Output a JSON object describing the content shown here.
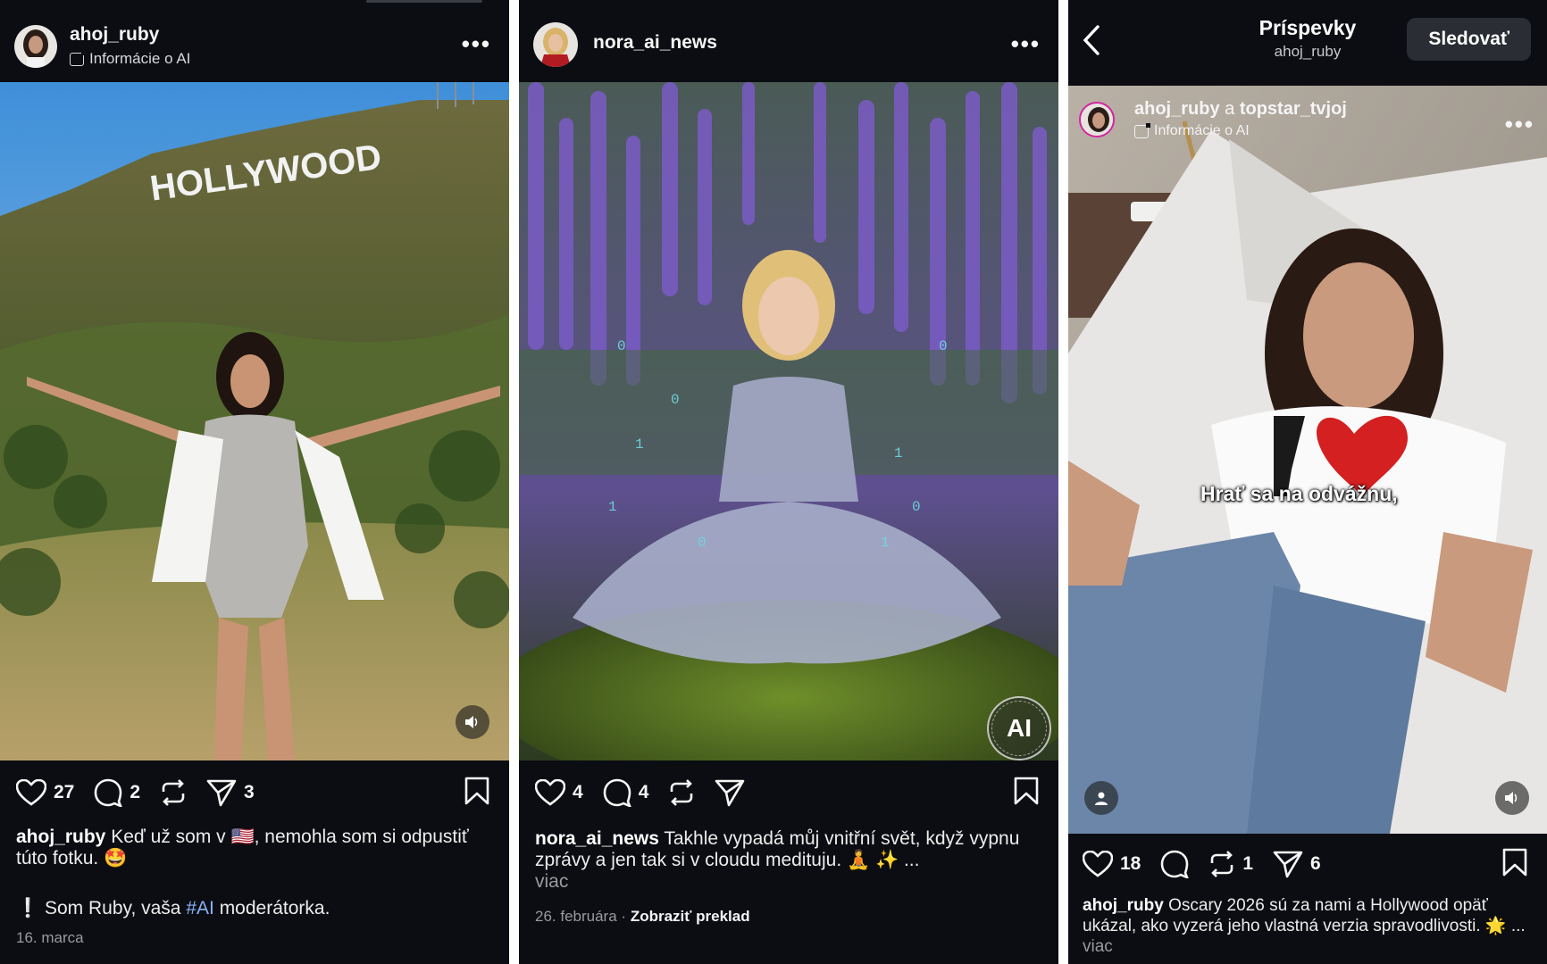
{
  "post1": {
    "username": "ahoj_ruby",
    "ai_info": "Informácie o AI",
    "more": "•••",
    "likes": "27",
    "comments": "2",
    "shares": "3",
    "caption_user": "ahoj_ruby",
    "caption_text": "Keď už som v 🇺🇸, nemohla som si odpustiť túto fotku. 🤩",
    "bio_line_prefix": "❕ Som Ruby, vaša ",
    "bio_hashtag": "#AI",
    "bio_line_suffix": " moderátorka.",
    "date": "16. marca",
    "sign_text": "HOLLYWOOD"
  },
  "post2": {
    "username": "nora_ai_news",
    "more": "•••",
    "likes": "4",
    "comments": "4",
    "caption_user": "nora_ai_news",
    "caption_text": "Takhle vypadá můj vnitřní svět, když vypnu zprávy a jen tak si v cloudu medituju. 🧘 ✨ ...",
    "more_link": "viac",
    "date": "26. februára",
    "separator": "·",
    "translate": "Zobraziť preklad",
    "ai_badge": "AI"
  },
  "post3": {
    "header_title": "Príspevky",
    "header_subtitle": "ahoj_ruby",
    "follow_label": "Sledovať",
    "user1": "ahoj_ruby",
    "connector": "a",
    "user2": "topstar_tvjoj",
    "ai_info": "Informácie o AI",
    "more": "•••",
    "overlay_caption": "Hrať sa na odvážnu,",
    "likes": "18",
    "reposts": "1",
    "shares": "6",
    "caption_user": "ahoj_ruby",
    "caption_text": "Oscary 2026 sú za nami a Hollywood opäť ukázal, ako vyzerá jeho vlastná verzia spravodlivosti. 🌟 ...",
    "more_link": "viac"
  },
  "colors": {
    "background": "#0b0d12",
    "hashtag": "#8ab4f8",
    "button": "#2a2d33"
  }
}
